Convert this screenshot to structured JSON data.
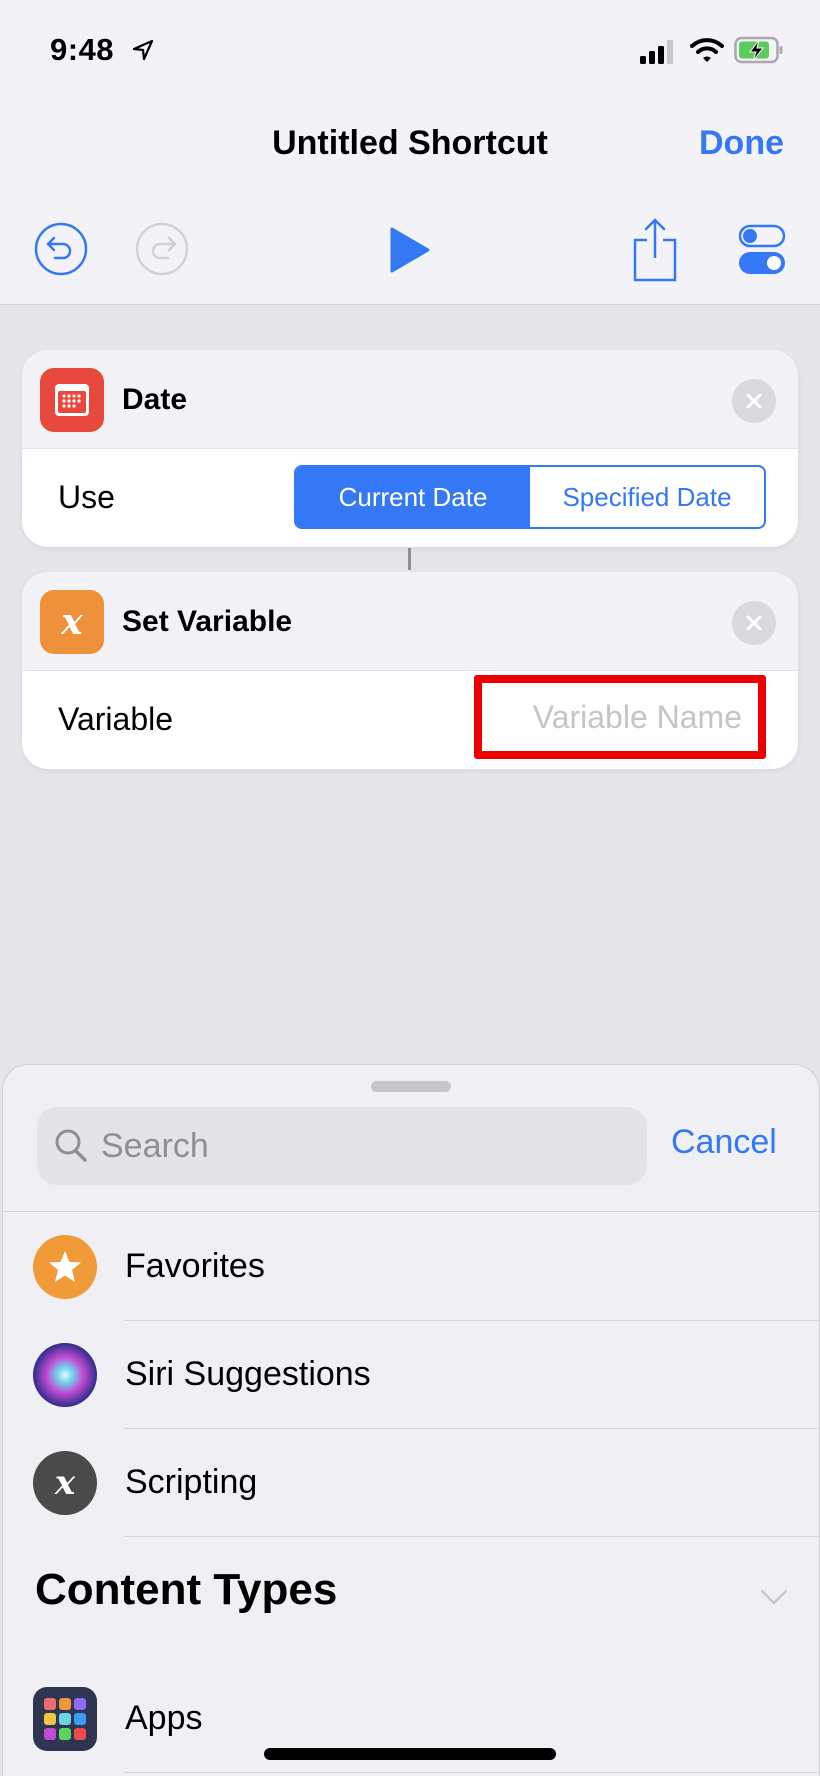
{
  "status_bar": {
    "time": "9:48",
    "location_icon": "location-arrow-icon",
    "signal_icon": "cellular-signal-icon",
    "wifi_icon": "wifi-icon",
    "battery_icon": "battery-charging-icon"
  },
  "nav": {
    "title": "Untitled Shortcut",
    "done_label": "Done"
  },
  "toolbar": {
    "undo_icon": "undo-icon",
    "redo_icon": "redo-icon",
    "play_icon": "play-icon",
    "share_icon": "share-icon",
    "settings_icon": "toggle-settings-icon",
    "redo_enabled": false
  },
  "actions": [
    {
      "title": "Date",
      "icon": "calendar-icon",
      "icon_color": "#e8483d",
      "row_label": "Use",
      "segments": [
        "Current Date",
        "Specified Date"
      ],
      "selected_segment": "Current Date"
    },
    {
      "title": "Set Variable",
      "icon": "variable-x-icon",
      "icon_color": "#ef913a",
      "row_label": "Variable",
      "input_value": "",
      "input_placeholder": "Variable Name",
      "highlight_color": "#ee0000"
    }
  ],
  "sheet": {
    "search_placeholder": "Search",
    "cancel_label": "Cancel",
    "items": [
      {
        "label": "Favorites",
        "icon": "star-icon",
        "color": "#f19a38"
      },
      {
        "label": "Siri Suggestions",
        "icon": "siri-icon",
        "color": "#2a2460"
      },
      {
        "label": "Scripting",
        "icon": "variable-x-icon",
        "color": "#4a4a4a"
      }
    ],
    "section_title": "Content Types",
    "section_items": [
      {
        "label": "Apps",
        "icon": "apps-grid-icon",
        "color": "#2e3550"
      }
    ]
  },
  "colors": {
    "accent": "#3478f6",
    "background": "#e5e5ea"
  }
}
